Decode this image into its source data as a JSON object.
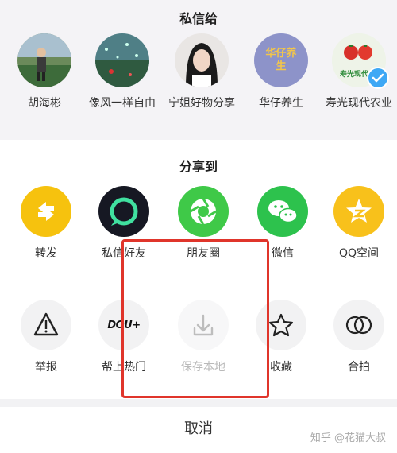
{
  "dm_section": {
    "title": "私信给",
    "contacts": [
      {
        "name": "胡海彬",
        "avatar_icon": "person-outdoor-photo-icon"
      },
      {
        "name": "像风一样自由",
        "avatar_icon": "rainy-window-photo-icon"
      },
      {
        "name": "宁姐好物分享",
        "avatar_icon": "woman-portrait-photo-icon"
      },
      {
        "name": "华仔养生",
        "avatar_icon": "text-logo-avatar-icon",
        "avatar_text": "华仔养生"
      },
      {
        "name": "寿光现代农业",
        "avatar_icon": "tomato-photo-icon",
        "avatar_text": "寿光现代",
        "verified": true
      }
    ]
  },
  "share_section": {
    "title": "分享到",
    "items": [
      {
        "label": "转发",
        "icon": "repost-icon",
        "color": "#f6c20e"
      },
      {
        "label": "私信好友",
        "icon": "message-friend-icon",
        "color": "#161823"
      },
      {
        "label": "朋友圈",
        "icon": "moments-icon",
        "color": "#3fc948"
      },
      {
        "label": "微信",
        "icon": "wechat-icon",
        "color": "#2dc24d"
      },
      {
        "label": "QQ空间",
        "icon": "qzone-icon",
        "color": "#f8c11b"
      }
    ]
  },
  "action_section": {
    "items": [
      {
        "label": "举报",
        "icon": "warning-icon"
      },
      {
        "label": "帮上热门",
        "icon": "dou-plus-icon",
        "icon_text": "DOU+"
      },
      {
        "label": "保存本地",
        "icon": "download-icon",
        "disabled": true
      },
      {
        "label": "收藏",
        "icon": "star-icon"
      },
      {
        "label": "合拍",
        "icon": "duet-icon"
      }
    ]
  },
  "cancel_label": "取消",
  "watermark": "知乎 @花猫大叔",
  "colors": {
    "highlight": "#e0352b",
    "top_band": "#f4f3f6",
    "action_circle": "#f2f2f3"
  }
}
